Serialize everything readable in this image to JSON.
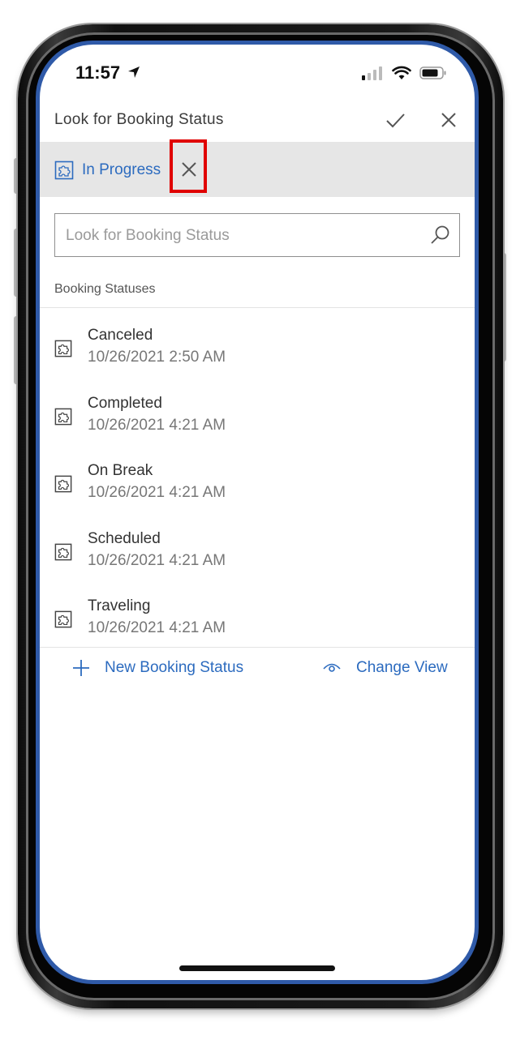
{
  "status_bar": {
    "time": "11:57"
  },
  "header": {
    "title": "Look for Booking Status"
  },
  "selected_chip": {
    "label": "In Progress"
  },
  "search": {
    "placeholder": "Look for Booking Status"
  },
  "section": {
    "label": "Booking Statuses"
  },
  "items": [
    {
      "name": "Canceled",
      "date": "10/26/2021 2:50 AM"
    },
    {
      "name": "Completed",
      "date": "10/26/2021 4:21 AM"
    },
    {
      "name": "On Break",
      "date": "10/26/2021 4:21 AM"
    },
    {
      "name": "Scheduled",
      "date": "10/26/2021 4:21 AM"
    },
    {
      "name": "Traveling",
      "date": "10/26/2021 4:21 AM"
    }
  ],
  "actions": {
    "new_label": "New Booking Status",
    "change_view_label": "Change View"
  },
  "colors": {
    "accent": "#2c6bbf",
    "highlight": "#e00000",
    "chip_bar": "#e6e6e6"
  }
}
